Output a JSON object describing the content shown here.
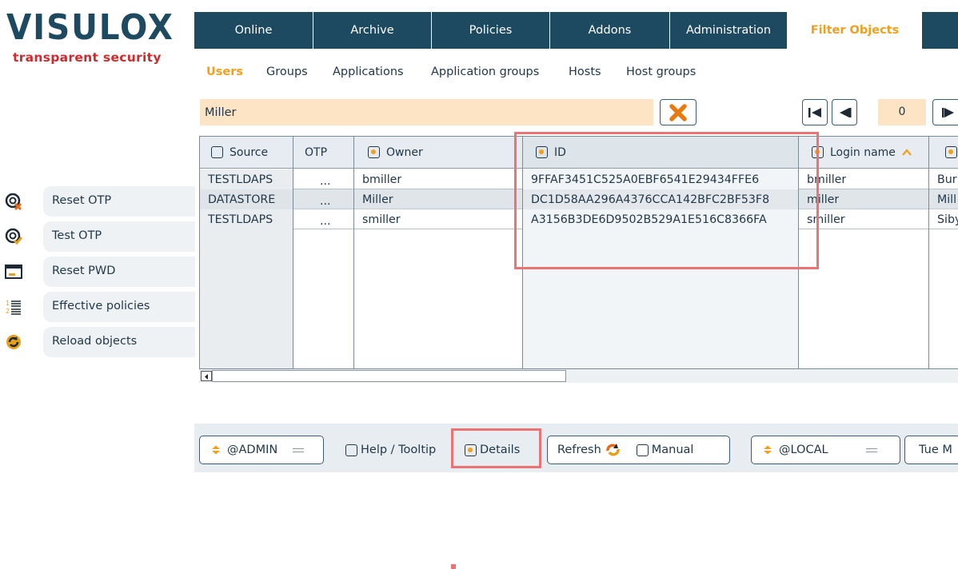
{
  "logo": {
    "title": "VISULOX",
    "tagline": "transparent security"
  },
  "colors": {
    "navy": "#1d4a60",
    "accent": "#f39f1c",
    "brand_red": "#d3282c",
    "search_bg": "#fde4c4",
    "annotation": "#ec7373"
  },
  "tabs": [
    {
      "label": "Online"
    },
    {
      "label": "Archive"
    },
    {
      "label": "Policies"
    },
    {
      "label": "Addons"
    },
    {
      "label": "Administration"
    },
    {
      "label": "Filter Objects",
      "active": true
    }
  ],
  "subtabs": [
    {
      "label": "Users",
      "active": true
    },
    {
      "label": "Groups"
    },
    {
      "label": "Applications"
    },
    {
      "label": "Application groups"
    },
    {
      "label": "Hosts"
    },
    {
      "label": "Host groups"
    }
  ],
  "search": {
    "value": "Miller",
    "clear_icon": "close-x-icon"
  },
  "pager": {
    "page": "0"
  },
  "actions": [
    {
      "label": "Reset OTP",
      "icon": "otp-reset-icon"
    },
    {
      "label": "Test OTP",
      "icon": "otp-test-icon"
    },
    {
      "label": "Reset PWD",
      "icon": "password-card-icon"
    },
    {
      "label": "Effective policies",
      "icon": "numbered-list-icon"
    },
    {
      "label": "Reload objects",
      "icon": "reload-icon"
    }
  ],
  "grid": {
    "columns": [
      {
        "label": "Source",
        "checkbox": "off"
      },
      {
        "label": "OTP",
        "checkbox": "none"
      },
      {
        "label": "Owner",
        "checkbox": "on"
      },
      {
        "label": "ID",
        "checkbox": "on"
      },
      {
        "label": "Login name",
        "checkbox": "on",
        "sort": "asc"
      },
      {
        "label": "",
        "checkbox": "on"
      }
    ],
    "rows": [
      {
        "source": "TESTLDAPS",
        "otp": "...",
        "owner": "bmiller",
        "id": "9FFAF3451C525A0EBF6541E29434FFE6",
        "login": "bmiller",
        "next": "Bur"
      },
      {
        "source": "DATASTORE",
        "otp": "...",
        "owner": "Miller",
        "id": "DC1D58AA296A4376CCA142BFC2BF53F8",
        "login": "miller",
        "next": "Mill"
      },
      {
        "source": "TESTLDAPS",
        "otp": "...",
        "owner": "smiller",
        "id": "A3156B3DE6D9502B529A1E516C8366FA",
        "login": "smiller",
        "next": "Siby"
      }
    ]
  },
  "bottom": {
    "admin": "@ADMIN",
    "help_tooltip": "Help / Tooltip",
    "details": "Details",
    "refresh": "Refresh",
    "manual": "Manual",
    "local": "@LOCAL",
    "date": "Tue M"
  }
}
